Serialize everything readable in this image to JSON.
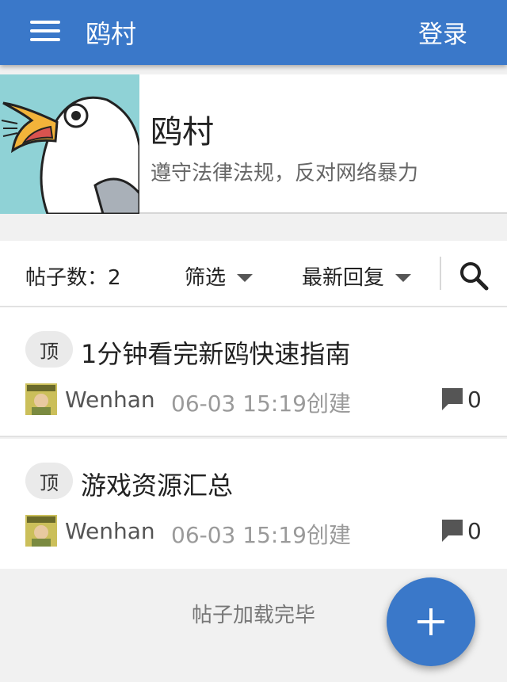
{
  "appbar": {
    "title": "鸥村",
    "login_label": "登录"
  },
  "board": {
    "title": "鸥村",
    "description": "遵守法律法规，反对网络暴力"
  },
  "toolbar": {
    "count_text": "帖子数：2",
    "filter_label": "筛选",
    "sort_label": "最新回复"
  },
  "posts": [
    {
      "badge": "顶",
      "title": "1分钟看完新鸥快速指南",
      "author": "Wenhan",
      "time": "06-03 15:19创建",
      "comments": "0"
    },
    {
      "badge": "顶",
      "title": "游戏资源汇总",
      "author": "Wenhan",
      "time": "06-03 15:19创建",
      "comments": "0"
    }
  ],
  "footer": {
    "text": "帖子加载完毕"
  },
  "fab": {
    "icon": "plus-icon"
  },
  "colors": {
    "primary": "#3a78c9",
    "cover_bg": "#8fd2d6"
  }
}
